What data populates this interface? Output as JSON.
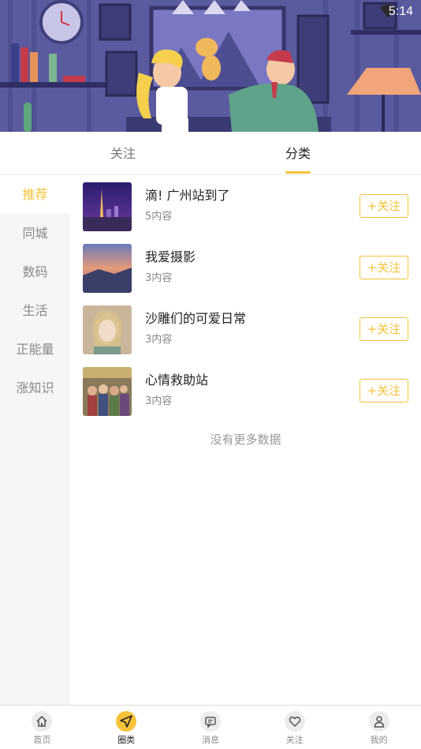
{
  "status_bar": {
    "time": "5:14"
  },
  "top_tabs": [
    {
      "label": "关注",
      "active": false
    },
    {
      "label": "分类",
      "active": true
    }
  ],
  "sidebar": {
    "items": [
      {
        "label": "推荐",
        "active": true
      },
      {
        "label": "同城",
        "active": false
      },
      {
        "label": "数码",
        "active": false
      },
      {
        "label": "生活",
        "active": false
      },
      {
        "label": "正能量",
        "active": false
      },
      {
        "label": "涨知识",
        "active": false
      }
    ]
  },
  "list": {
    "items": [
      {
        "title": "滴! 广州站到了",
        "count": "5内容",
        "follow_label": "+关注"
      },
      {
        "title": "我爱摄影",
        "count": "3内容",
        "follow_label": "+关注"
      },
      {
        "title": "沙雕们的可爱日常",
        "count": "3内容",
        "follow_label": "+关注"
      },
      {
        "title": "心情救助站",
        "count": "3内容",
        "follow_label": "+关注"
      }
    ],
    "no_more": "没有更多数据"
  },
  "bottom_nav": {
    "items": [
      {
        "label": "首页",
        "icon": "home-icon",
        "active": false
      },
      {
        "label": "圈类",
        "icon": "send-icon",
        "active": true
      },
      {
        "label": "消息",
        "icon": "message-icon",
        "active": false
      },
      {
        "label": "关注",
        "icon": "heart-icon",
        "active": false
      },
      {
        "label": "我的",
        "icon": "user-icon",
        "active": false
      }
    ]
  },
  "colors": {
    "accent": "#f4c339",
    "sidebar_bg": "#f6f6f6",
    "banner_bg": "#5b5aa0"
  }
}
